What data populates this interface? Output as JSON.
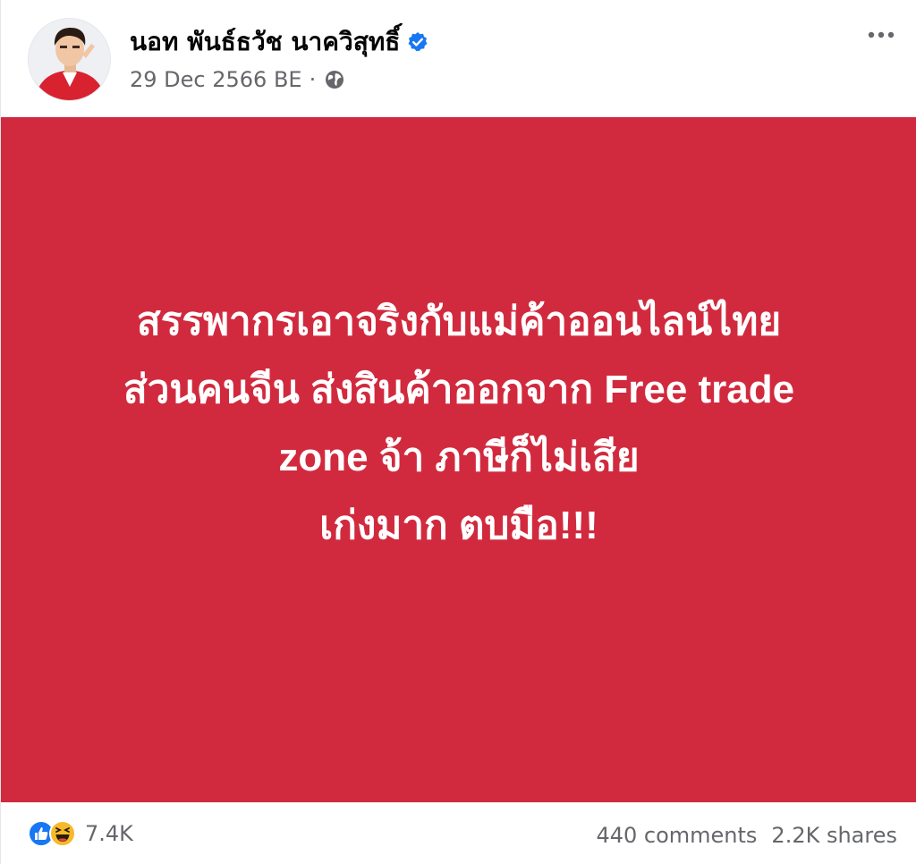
{
  "post": {
    "author": "นอท พันธ์ธวัช นาควิสุทธิ์",
    "date": "29 Dec 2566 BE",
    "separator": "·",
    "privacy_icon": "globe-icon",
    "verified_icon": "verified-badge-icon",
    "menu_icon": "more-options-icon"
  },
  "content": {
    "background_color": "#d12a3e",
    "text_color": "#ffffff",
    "lines": [
      "สรรพากรเอาจริงกับแม่ค้าออนไลน์ไทย",
      "ส่วนคนจีน ส่งสินค้าออกจาก Free trade",
      "zone จ้า ภาษีก็ไม่เสีย",
      "เก่งมาก ตบมือ!!!"
    ]
  },
  "footer": {
    "reaction_icons": [
      "like-icon",
      "haha-icon"
    ],
    "reaction_count": "7.4K",
    "comments": "440 comments",
    "shares": "2.2K shares"
  },
  "colors": {
    "accent": "#1877f2",
    "muted_text": "#65676b"
  }
}
